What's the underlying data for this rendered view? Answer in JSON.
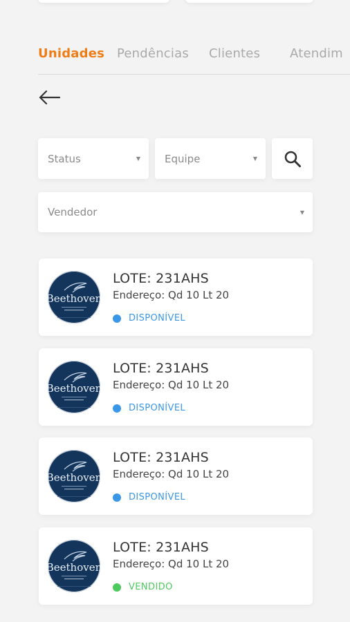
{
  "tabs": [
    {
      "label": "Unidades",
      "active": true
    },
    {
      "label": "Pendências",
      "active": false
    },
    {
      "label": "Clientes",
      "active": false
    },
    {
      "label": "Atendim",
      "active": false
    }
  ],
  "filters": {
    "status": "Status",
    "team": "Equipe",
    "seller": "Vendedor"
  },
  "icons": {
    "back": "arrow-left-icon",
    "search": "search-icon",
    "caret": "caret-down-icon"
  },
  "colors": {
    "accent": "#ef7d17",
    "available": "#3a97e8",
    "sold": "#4cca5c",
    "logo_bg": "#13355c"
  },
  "units": [
    {
      "logo_text": "Beethoven",
      "title": "LOTE: 231AHS",
      "address": "Endereço: Qd 10 Lt 20",
      "status": "DISPONÍVEL",
      "status_type": "available"
    },
    {
      "logo_text": "Beethoven",
      "title": "LOTE: 231AHS",
      "address": "Endereço: Qd 10 Lt 20",
      "status": "DISPONÍVEL",
      "status_type": "available"
    },
    {
      "logo_text": "Beethoven",
      "title": "LOTE: 231AHS",
      "address": "Endereço: Qd 10 Lt 20",
      "status": "DISPONÍVEL",
      "status_type": "available"
    },
    {
      "logo_text": "Beethoven",
      "title": "LOTE: 231AHS",
      "address": "Endereço: Qd 10 Lt 20",
      "status": "VENDIDO",
      "status_type": "sold"
    }
  ]
}
